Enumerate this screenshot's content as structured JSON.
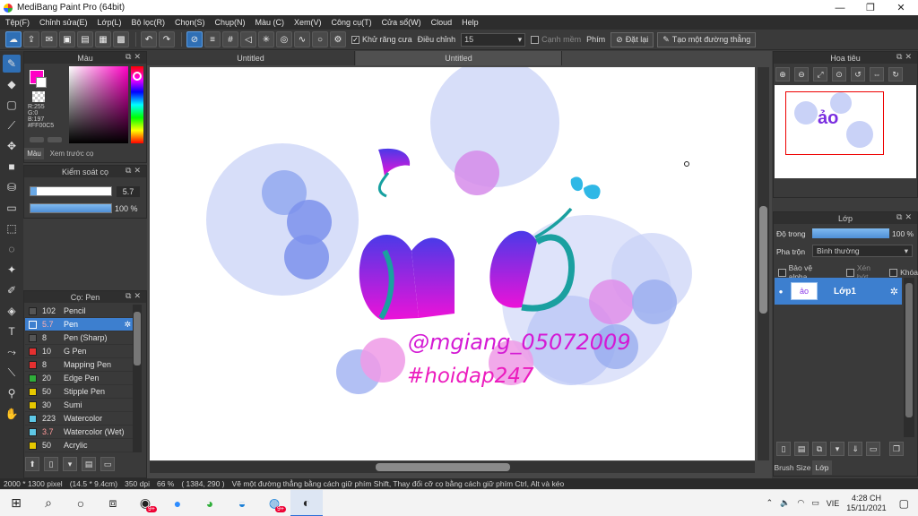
{
  "window": {
    "title": "MediBang Paint Pro (64bit)",
    "minimize": "—",
    "restore": "❐",
    "close": "✕"
  },
  "menu": [
    "Tệp(F)",
    "Chỉnh sửa(E)",
    "Lớp(L)",
    "Bộ lọc(R)",
    "Chọn(S)",
    "Chụp(N)",
    "Màu (C)",
    "Xem(V)",
    "Công cụ(T)",
    "Cửa sổ(W)",
    "Cloud",
    "Help"
  ],
  "toolbar": {
    "antialias_label": "Khử răng cưa",
    "correction_label": "Điều chỉnh",
    "correction_value": "15",
    "edge_label": "Cạnh mềm",
    "key_label": "Phím",
    "reset_label": "Đặt lại",
    "straight_label": "Tạo một đường thẳng"
  },
  "tabs": {
    "tab1": "Untitled",
    "tab2": "Untitled"
  },
  "color_panel": {
    "title": "Màu",
    "r": "R:255",
    "g": "G:0",
    "b": "B:197",
    "hex": "#FF00C5",
    "tab_color": "Màu",
    "tab_preview": "Xem trước cọ",
    "foreground": "#ff00c5",
    "background": "#ffffff"
  },
  "brush_control": {
    "title": "Kiểm soát cọ",
    "size": "5.7",
    "opacity": "100 %"
  },
  "brush_list": {
    "title": "Cọ: Pen",
    "items": [
      {
        "size": "102",
        "name": "Pencil",
        "color": "#555555"
      },
      {
        "size": "5.7",
        "name": "Pen",
        "color": "#3d7fcf"
      },
      {
        "size": "8",
        "name": "Pen (Sharp)",
        "color": "#555555"
      },
      {
        "size": "10",
        "name": "G Pen",
        "color": "#e53030"
      },
      {
        "size": "8",
        "name": "Mapping Pen",
        "color": "#e53030"
      },
      {
        "size": "20",
        "name": "Edge Pen",
        "color": "#2fae3a"
      },
      {
        "size": "50",
        "name": "Stipple Pen",
        "color": "#e6c800"
      },
      {
        "size": "30",
        "name": "Sumi",
        "color": "#e6c800"
      },
      {
        "size": "223",
        "name": "Watercolor",
        "color": "#5ec8e6"
      },
      {
        "size": "3.7",
        "name": "Watercolor (Wet)",
        "color": "#5ec8e6"
      },
      {
        "size": "50",
        "name": "Acrylic",
        "color": "#e6c800"
      }
    ]
  },
  "canvas_text": {
    "word": "ảo",
    "handle1": "@mgiang_05072009",
    "handle2": "#hoidap247"
  },
  "navigator": {
    "title": "Hoa tiêu"
  },
  "layer_panel": {
    "title": "Lớp",
    "opacity_label": "Độ trong",
    "opacity_value": "100 %",
    "blend_label": "Pha trộn",
    "blend_value": "Bình thường",
    "protect_alpha": "Bảo vệ alpha",
    "clipping": "Xén bớt",
    "lock": "Khóa",
    "layer_name": "Lớp1",
    "bottom_tab_brush": "Brush Size",
    "bottom_tab_layer": "Lớp"
  },
  "status": {
    "size": "2000 * 1300 pixel",
    "dimensions": "(14.5 * 9.4cm)",
    "dpi": "350 dpi",
    "zoom": "66 %",
    "coords": "( 1384, 290 )",
    "hint": "Vẽ một đường thẳng bằng cách giữ phím Shift, Thay đổi cỡ cọ bằng cách giữ phím Ctrl, Alt và kéo"
  },
  "taskbar": {
    "lang": "VIE",
    "time": "4:28 CH",
    "date": "15/11/2021",
    "badge1": "9+",
    "badge2": "9+"
  }
}
